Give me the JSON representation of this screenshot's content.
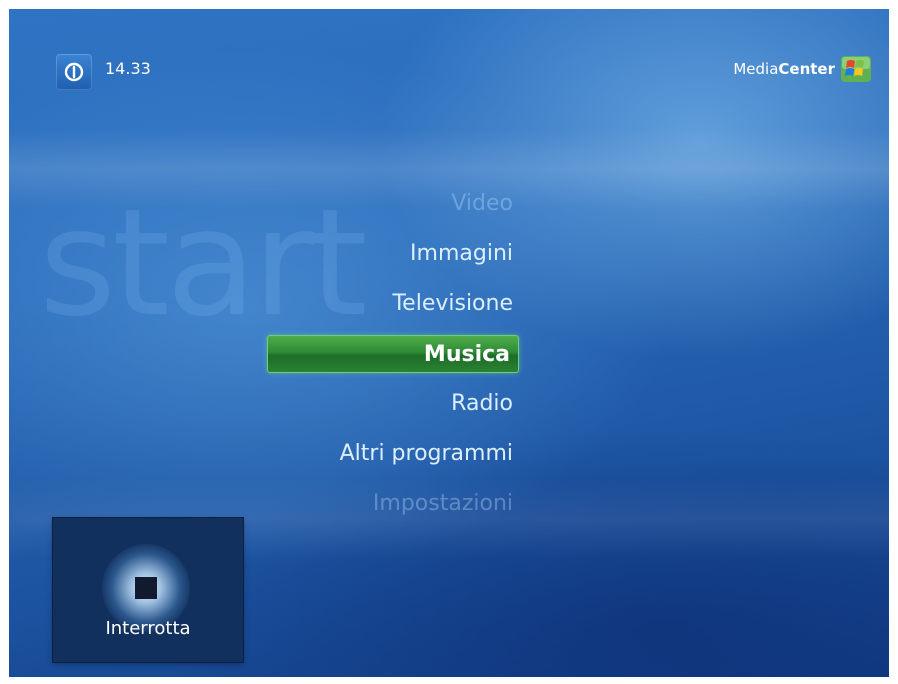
{
  "header": {
    "clock": "14.33",
    "brand_prefix": "Media",
    "brand_bold": "Center"
  },
  "watermark": "start",
  "menu": {
    "items": [
      {
        "label": "Video",
        "state": "faded"
      },
      {
        "label": "Immagini",
        "state": "normal"
      },
      {
        "label": "Televisione",
        "state": "normal"
      },
      {
        "label": "Musica",
        "state": "selected"
      },
      {
        "label": "Radio",
        "state": "normal"
      },
      {
        "label": "Altri programmi",
        "state": "normal"
      },
      {
        "label": "Impostazioni",
        "state": "faded"
      }
    ]
  },
  "now_playing": {
    "status": "Interrotta",
    "icon": "stop-icon"
  },
  "colors": {
    "background": "#2a6ab9",
    "selection": "#2f8a36",
    "text": "#dbefff",
    "panel": "#12305d"
  },
  "icons": {
    "power": "power-icon",
    "logo": "windows-flag-icon"
  }
}
